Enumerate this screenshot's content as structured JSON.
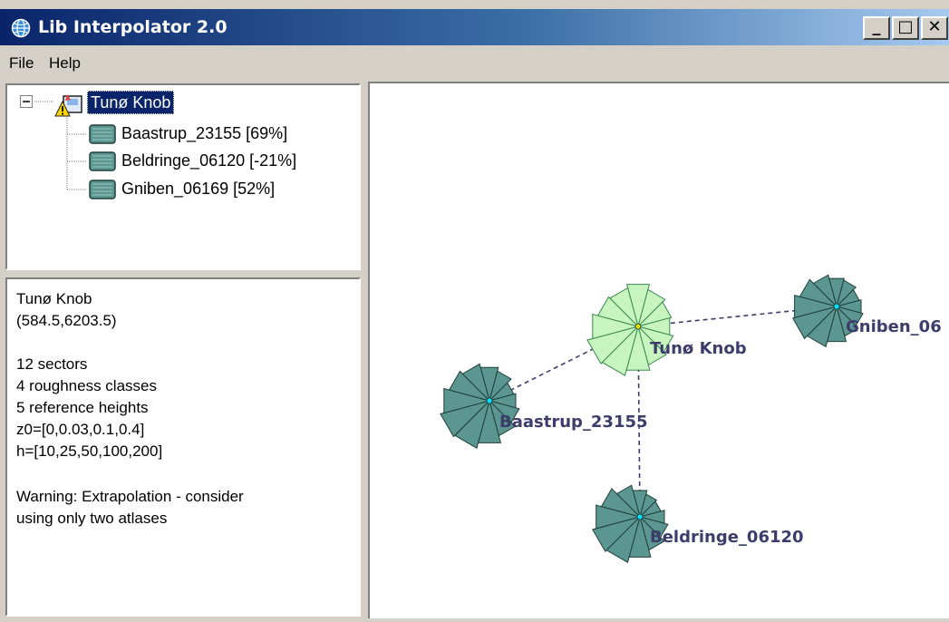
{
  "window": {
    "title": "Lib Interpolator 2.0",
    "controls": {
      "minimize": "_",
      "maximize": "□",
      "close": "✕"
    }
  },
  "menu": {
    "items": [
      "File",
      "Help"
    ]
  },
  "tree": {
    "root": "Tunø Knob",
    "children": [
      "Baastrup_23155 [69%]",
      "Beldringe_06120 [-21%]",
      "Gniben_06169 [52%]"
    ]
  },
  "info": {
    "lines": [
      "Tunø Knob",
      "(584.5,6203.5)",
      "12 sectors",
      "4 roughness classes",
      "5 reference heights",
      "z0=[0,0.03,0.1,0.4]",
      "h=[10,25,50,100,200]",
      "Warning: Extrapolation - consider",
      "using only two atlases"
    ]
  },
  "map": {
    "sites": [
      {
        "name": "Tunø Knob",
        "role": "target",
        "color": "#c8f4c0"
      },
      {
        "name": "Baastrup_23155",
        "role": "atlas",
        "color": "#5b9690"
      },
      {
        "name": "Beldringe_06120",
        "role": "atlas",
        "color": "#5b9690"
      },
      {
        "name": "Gniben_06",
        "role": "atlas",
        "color": "#5b9690"
      }
    ]
  },
  "colors": {
    "title_gradient_start": "#0a246a",
    "title_gradient_end": "#a6caf0",
    "atlas_fill": "#5b9690",
    "target_fill": "#c8f4c0",
    "link_line": "#3d3d6b"
  }
}
